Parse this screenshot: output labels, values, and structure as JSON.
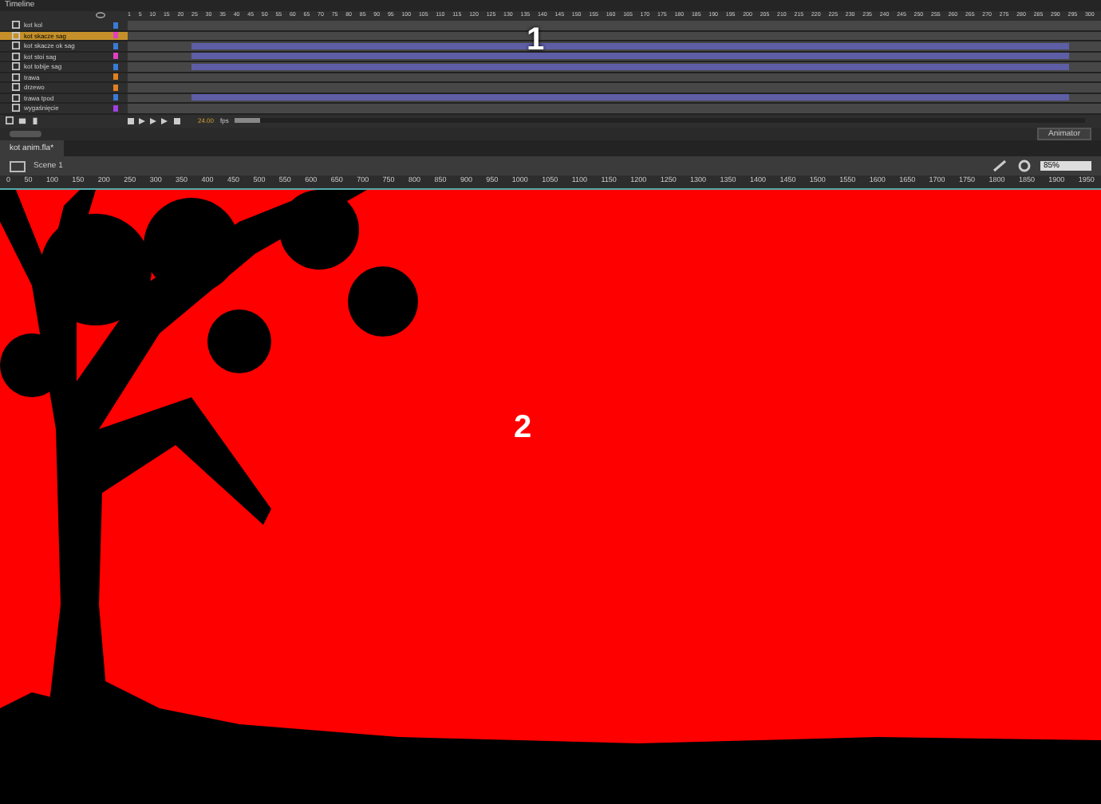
{
  "timeline": {
    "title": "Timeline",
    "layers": [
      {
        "name": "kot kol",
        "color": "#3a7bd5",
        "selected": false,
        "tweened": false
      },
      {
        "name": "kot skacze sag",
        "color": "#e040c0",
        "selected": true,
        "tweened": false
      },
      {
        "name": "kot skacze ok sag",
        "color": "#3a7bd5",
        "selected": false,
        "tweened": true
      },
      {
        "name": "kot stoi sag",
        "color": "#e040c0",
        "selected": false,
        "tweened": true
      },
      {
        "name": "kot tobije sag",
        "color": "#3a7bd5",
        "selected": false,
        "tweened": true
      },
      {
        "name": "trawa",
        "color": "#e08020",
        "selected": false,
        "tweened": false
      },
      {
        "name": "drzewo",
        "color": "#e08020",
        "selected": false,
        "tweened": false
      },
      {
        "name": "trawa tpod",
        "color": "#3a7bd5",
        "selected": false,
        "tweened": true
      },
      {
        "name": "wygaśnięcie",
        "color": "#a040e0",
        "selected": false,
        "tweened": false
      }
    ],
    "frames": [
      "1",
      "5",
      "10",
      "15",
      "20",
      "25",
      "30",
      "35",
      "40",
      "45",
      "50",
      "55",
      "60",
      "65",
      "70",
      "75",
      "80",
      "85",
      "90",
      "95",
      "100",
      "105",
      "110",
      "115",
      "120",
      "125",
      "130",
      "135",
      "140",
      "145",
      "150",
      "155",
      "160",
      "165",
      "170",
      "175",
      "180",
      "185",
      "190",
      "195",
      "200",
      "205",
      "210",
      "215",
      "220",
      "225",
      "230",
      "235",
      "240",
      "245",
      "250",
      "255",
      "260",
      "265",
      "270",
      "275",
      "280",
      "285",
      "290",
      "295",
      "300"
    ],
    "fps": "24.00",
    "fps_unit": "fps"
  },
  "workspace": "Animator",
  "document_tab": "kot anim.fla*",
  "scene": "Scene 1",
  "zoom": "85%",
  "ruler": [
    "0",
    "50",
    "100",
    "150",
    "200",
    "250",
    "300",
    "350",
    "400",
    "450",
    "500",
    "550",
    "600",
    "650",
    "700",
    "750",
    "800",
    "850",
    "900",
    "950",
    "1000",
    "1050",
    "1100",
    "1150",
    "1200",
    "1250",
    "1300",
    "1350",
    "1400",
    "1450",
    "1500",
    "1550",
    "1600",
    "1650",
    "1700",
    "1750",
    "1800",
    "1850",
    "1900",
    "1950"
  ],
  "callouts": [
    "1",
    "2"
  ]
}
